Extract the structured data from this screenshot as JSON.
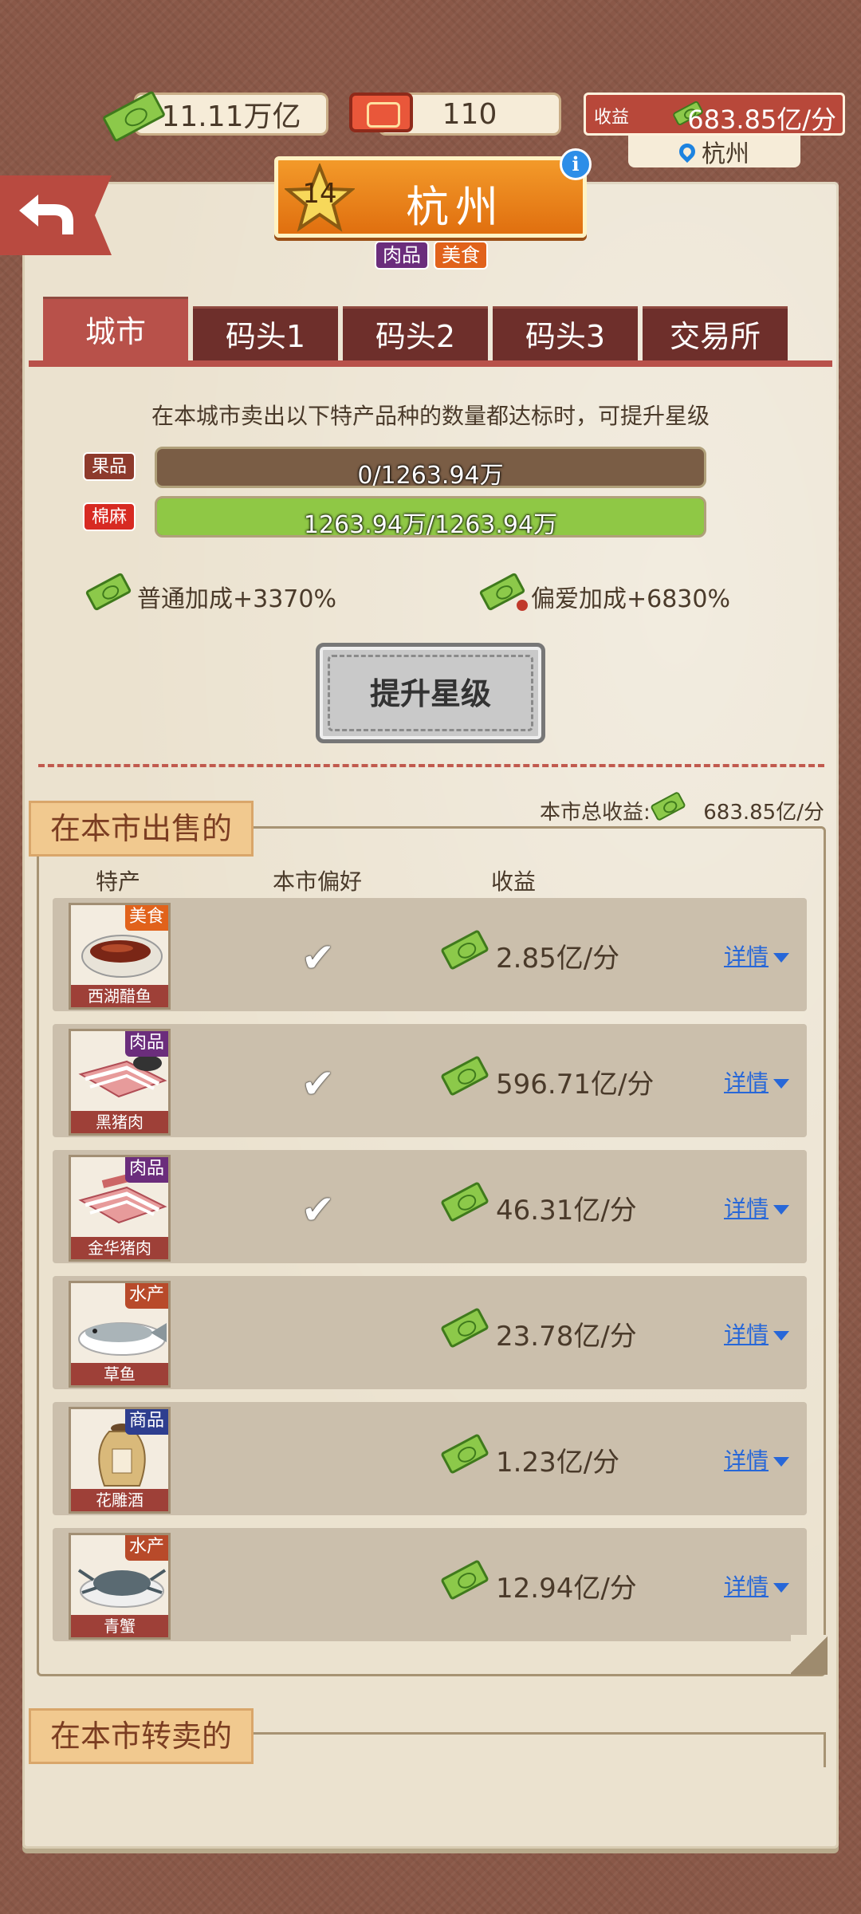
{
  "resources": {
    "cash": "11.11万亿",
    "tickets": "110",
    "income_label": "收益",
    "income_value": "683.85亿/分",
    "location": "杭州"
  },
  "city": {
    "name": "杭州",
    "star_level": "14",
    "tags": [
      {
        "label": "肉品",
        "color": "#6b2d7c"
      },
      {
        "label": "美食",
        "color": "#e1621b"
      }
    ]
  },
  "tabs": [
    "城市",
    "码头1",
    "码头2",
    "码头3",
    "交易所"
  ],
  "requirements": {
    "description": "在本城市卖出以下特产品种的数量都达标时，可提升星级",
    "items": [
      {
        "label": "果品",
        "label_color": "#8e3a2c",
        "progress_text": "0/1263.94万",
        "progress": 0.0
      },
      {
        "label": "棉麻",
        "label_color": "#d72a22",
        "progress_text": "1263.94万/1263.94万",
        "progress": 1.0
      }
    ],
    "normal_bonus": "普通加成+3370%",
    "favorite_bonus": "偏爱加成+6830%",
    "upgrade_button": "提升星级"
  },
  "sell": {
    "header": "在本市出售的",
    "total_label": "本市总收益:",
    "total_value": "683.85亿/分",
    "columns": [
      "特产",
      "本市偏好",
      "收益"
    ],
    "detail_label": "详情",
    "rows": [
      {
        "name": "西湖醋鱼",
        "category": "美食",
        "category_color": "#e1621b",
        "preferred": true,
        "income": "2.85亿/分"
      },
      {
        "name": "黑猪肉",
        "category": "肉品",
        "category_color": "#6b2d7c",
        "preferred": true,
        "income": "596.71亿/分"
      },
      {
        "name": "金华猪肉",
        "category": "肉品",
        "category_color": "#6b2d7c",
        "preferred": true,
        "income": "46.31亿/分"
      },
      {
        "name": "草鱼",
        "category": "水产",
        "category_color": "#b84a2a",
        "preferred": false,
        "income": "23.78亿/分"
      },
      {
        "name": "花雕酒",
        "category": "商品",
        "category_color": "#2e3e8f",
        "preferred": false,
        "income": "1.23亿/分"
      },
      {
        "name": "青蟹",
        "category": "水产",
        "category_color": "#b84a2a",
        "preferred": false,
        "income": "12.94亿/分"
      }
    ]
  },
  "resell": {
    "header": "在本市转卖的"
  }
}
